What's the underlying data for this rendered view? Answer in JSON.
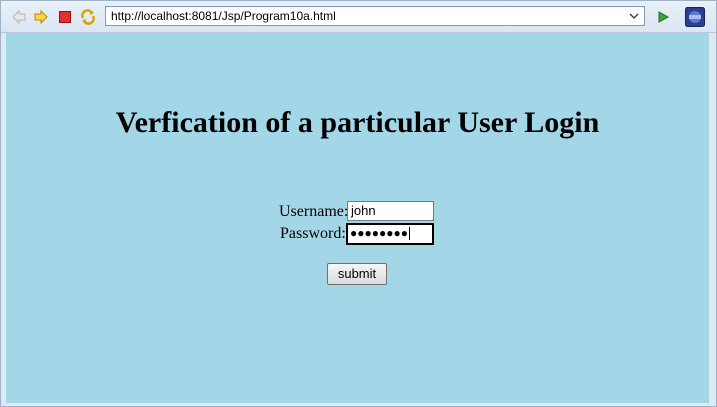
{
  "browser": {
    "url": "http://localhost:8081/Jsp/Program10a.html",
    "toolbar_icons": [
      "back-arrow-icon",
      "forward-arrow-icon",
      "stop-icon",
      "refresh-icon"
    ],
    "go_icon": "go-play-icon",
    "extra_icon": "eclipse-icon"
  },
  "page": {
    "heading": "Verfication of a particular User Login",
    "background_color": "#a3d6e6",
    "form": {
      "username_label": "Username:",
      "username_value": "john",
      "password_label": "Password:",
      "password_masked": "●●●●●●●●",
      "submit_label": "submit"
    }
  }
}
